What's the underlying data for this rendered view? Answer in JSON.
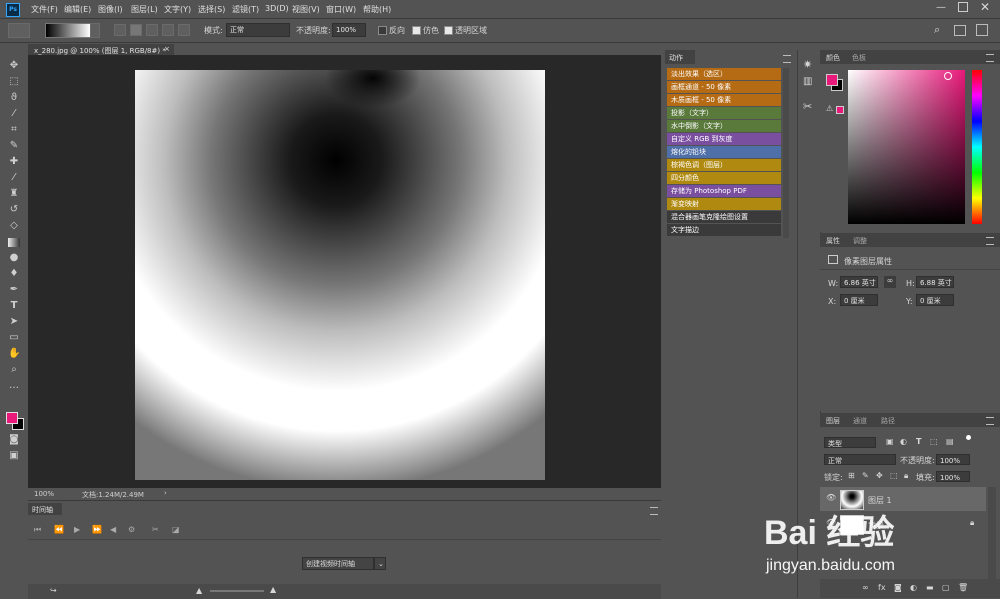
{
  "app": {
    "logo": "Ps"
  },
  "menu": [
    "文件(F)",
    "编辑(E)",
    "图像(I)",
    "图层(L)",
    "文字(Y)",
    "选择(S)",
    "滤镜(T)",
    "3D(D)",
    "视图(V)",
    "窗口(W)",
    "帮助(H)"
  ],
  "options": {
    "mode_label": "模式:",
    "mode_value": "正常",
    "opacity_label": "不透明度:",
    "opacity_value": "100%",
    "reverse": "反向",
    "dither": "仿色",
    "transparency": "透明区域"
  },
  "document": {
    "tab_title": "x_280.jpg @ 100% (图层 1, RGB/8#) *",
    "close": "×"
  },
  "status": {
    "zoom": "100%",
    "doc_info": "文档:1.24M/2.49M"
  },
  "timeline": {
    "title": "时间轴",
    "create_button": "创建视频时间轴"
  },
  "actions": {
    "title": "动作",
    "items": [
      {
        "label": "淡出效果（选区）",
        "color": "#b56b14"
      },
      {
        "label": "画框通道 - 50 像素",
        "color": "#b56b14"
      },
      {
        "label": "木质画框 - 50 像素",
        "color": "#b56b14"
      },
      {
        "label": "投影（文字）",
        "color": "#5a7a3c"
      },
      {
        "label": "水中倒影（文字）",
        "color": "#5a7a3c"
      },
      {
        "label": "自定义 RGB 到灰度",
        "color": "#7a4fa0"
      },
      {
        "label": "熔化的铅块",
        "color": "#4e6fa8"
      },
      {
        "label": "棕褐色调（图层）",
        "color": "#b08a10"
      },
      {
        "label": "四分颜色",
        "color": "#b08a10"
      },
      {
        "label": "存储为 Photoshop PDF",
        "color": "#7a4fa0"
      },
      {
        "label": "渐变映射",
        "color": "#b08a10"
      },
      {
        "label": "混合器画笔克隆绘图设置",
        "color": "#3a3a3a"
      },
      {
        "label": "文字描边",
        "color": "#3a3a3a"
      }
    ]
  },
  "color_panel": {
    "tab1": "颜色",
    "tab2": "色板",
    "foreground": "#e8197a",
    "background": "#000000"
  },
  "properties": {
    "tab1": "属性",
    "tab2": "调整",
    "subtitle": "像素图层属性",
    "w_label": "W:",
    "w_value": "6.86 英寸",
    "h_label": "H:",
    "h_value": "6.88 英寸",
    "x_label": "X:",
    "x_value": "0 厘米",
    "y_label": "Y:",
    "y_value": "0 厘米"
  },
  "layers": {
    "tab1": "图层",
    "tab2": "通道",
    "tab3": "路径",
    "kind": "类型",
    "blend": "正常",
    "opacity_label": "不透明度:",
    "opacity_value": "100%",
    "lock_label": "锁定:",
    "fill_label": "填充:",
    "fill_value": "100%",
    "items": [
      {
        "name": "图层 1"
      },
      {
        "name": "背景"
      }
    ]
  },
  "watermark": {
    "brand": "Bai 经验",
    "url": "jingyan.baidu.com"
  }
}
